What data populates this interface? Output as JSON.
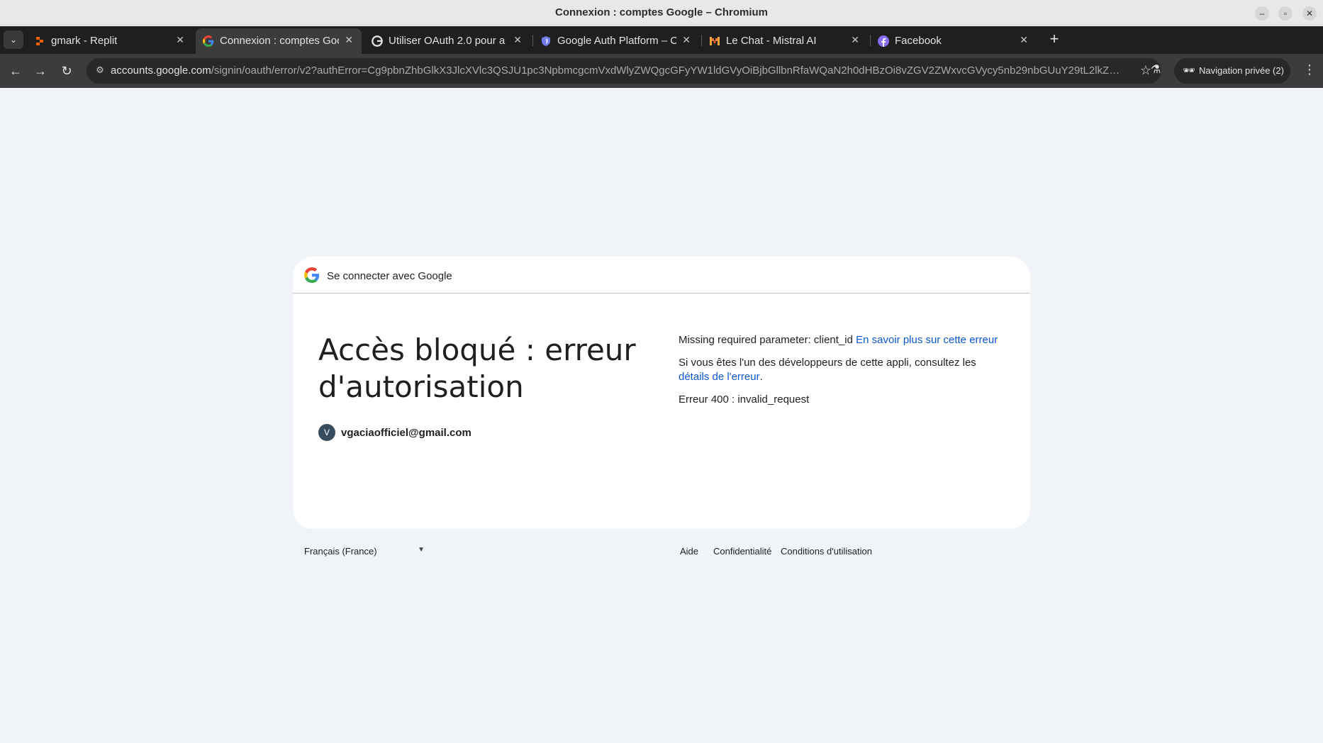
{
  "window": {
    "title": "Connexion : comptes Google – Chromium",
    "controls": [
      "minimize",
      "restore",
      "close"
    ]
  },
  "tabs": [
    {
      "label": "gmark - Replit",
      "icon": "replit-icon",
      "active": false
    },
    {
      "label": "Connexion : comptes Google",
      "icon": "google-icon",
      "active": true
    },
    {
      "label": "Utiliser OAuth 2.0 pour a",
      "icon": "google-icon",
      "active": false
    },
    {
      "label": "Google Auth Platform – C",
      "icon": "shield-icon",
      "active": false
    },
    {
      "label": "Le Chat - Mistral AI",
      "icon": "mistral-icon",
      "active": false
    },
    {
      "label": "Facebook",
      "icon": "facebook-icon",
      "active": false
    }
  ],
  "toolbar": {
    "url_host": "accounts.google.com",
    "url_rest": "/signin/oauth/error/v2?authError=Cg9pbnZhbGlkX3JlcXVlc3QSJU1pc3NpbmcgcmVxdWlyZWQgcGFyYW1ldGVyOiBjbGllbnRfaWQaN2h0dHBzOi8vZGV2ZWxvcGVycy5nb29nbGUuY29tL2lkZW50aXR5L3...",
    "incognito_label": "Navigation privée (2)"
  },
  "card": {
    "header": "Se connecter avec Google",
    "title": "Accès bloqué : erreur d'autorisation",
    "avatar_letter": "V",
    "email": "vgaciaofficiel@gmail.com",
    "missing_text": "Missing required parameter: client_id",
    "learn_more": "En savoir plus sur cette erreur",
    "dev_text": "Si vous êtes l'un des développeurs de cette appli, consultez les",
    "details_link": "détails de l'erreur",
    "period": ".",
    "error_code": "Erreur 400 : invalid_request"
  },
  "footer": {
    "language": "Français (France)",
    "help": "Aide",
    "privacy": "Confidentialité",
    "terms": "Conditions d'utilisation"
  },
  "colors": {
    "page_bg": "#f0f4f9",
    "link": "#0b57d0",
    "tabstrip": "#1f1f1f",
    "toolbar": "#3c3c3c"
  }
}
